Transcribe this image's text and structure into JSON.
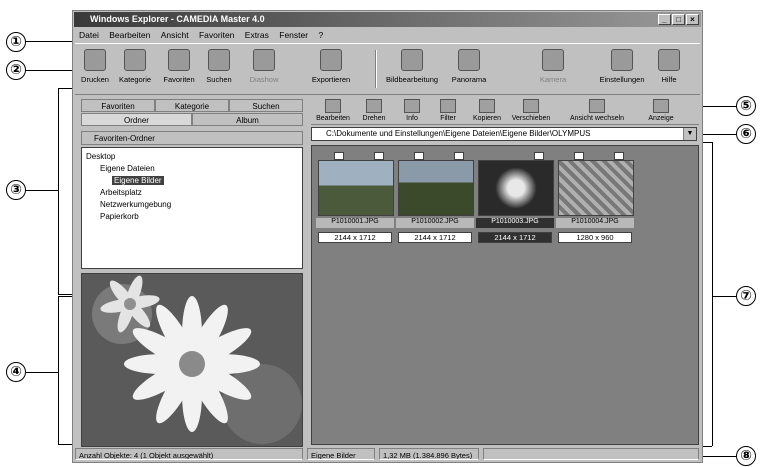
{
  "callouts": [
    "①",
    "②",
    "③",
    "④",
    "⑤",
    "⑥",
    "⑦",
    "⑧"
  ],
  "window": {
    "title": "Windows Explorer - CAMEDIA Master 4.0"
  },
  "menu": [
    "Datei",
    "Bearbeiten",
    "Ansicht",
    "Favoriten",
    "Extras",
    "Fenster",
    "?"
  ],
  "toolbar": [
    {
      "label": "Drucken",
      "icon": "printer-icon",
      "enabled": true
    },
    {
      "label": "Kategorie",
      "icon": "category-icon",
      "enabled": true
    },
    {
      "label": "Favoriten",
      "icon": "favorites-icon",
      "enabled": true
    },
    {
      "label": "Suchen",
      "icon": "search-icon",
      "enabled": true
    },
    {
      "label": "Diashow",
      "icon": "slideshow-icon",
      "enabled": false
    },
    {
      "label": "Exportieren",
      "icon": "export-icon",
      "enabled": true
    },
    {
      "label": "Bildbearbeitung",
      "icon": "edit-icon",
      "enabled": true
    },
    {
      "label": "Panorama",
      "icon": "panorama-icon",
      "enabled": true
    },
    {
      "label": "Kamera",
      "icon": "camera-icon",
      "enabled": false
    },
    {
      "label": "Einstellungen",
      "icon": "settings-icon",
      "enabled": true
    },
    {
      "label": "Hilfe",
      "icon": "help-icon",
      "enabled": true
    }
  ],
  "left": {
    "tabs": [
      "Favoriten",
      "Kategorie",
      "Suchen",
      "Ordner",
      "Album"
    ],
    "favorites_bar": "Favoriten-Ordner",
    "tree": [
      {
        "label": "Desktop",
        "level": 0,
        "selected": false
      },
      {
        "label": "Eigene Dateien",
        "level": 1,
        "selected": false
      },
      {
        "label": "Eigene Bilder",
        "level": 2,
        "selected": true
      },
      {
        "label": "Arbeitsplatz",
        "level": 1,
        "selected": false
      },
      {
        "label": "Netzwerkumgebung",
        "level": 1,
        "selected": false
      },
      {
        "label": "Papierkorb",
        "level": 1,
        "selected": false
      }
    ]
  },
  "imagetools": [
    {
      "label": "Bearbeiten",
      "icon": "edit-icon"
    },
    {
      "label": "Drehen",
      "icon": "rotate-icon"
    },
    {
      "label": "Info",
      "icon": "info-icon"
    },
    {
      "label": "Filter",
      "icon": "filter-icon"
    },
    {
      "label": "Kopieren",
      "icon": "copy-icon"
    },
    {
      "label": "Verschieben",
      "icon": "move-icon"
    },
    {
      "label": "Ansicht wechseln",
      "icon": "view-icon"
    },
    {
      "label": "Anzeige",
      "icon": "display-icon"
    }
  ],
  "address": "C:\\Dokumente und Einstellungen\\Eigene Dateien\\Eigene Bilder\\OLYMPUS",
  "thumbnails": [
    {
      "name": "P1010001.JPG",
      "size": "2144 x 1712",
      "selected": false,
      "colors": [
        "#9fb0c0",
        "#4a5a3a"
      ]
    },
    {
      "name": "P1010002.JPG",
      "size": "2144 x 1712",
      "selected": false,
      "colors": [
        "#8a9aa8",
        "#3a4a2a"
      ]
    },
    {
      "name": "P1010003.JPG",
      "size": "2144 x 1712",
      "selected": true,
      "colors": [
        "#2a2a2a",
        "#d8d8d8"
      ]
    },
    {
      "name": "P1010004.JPG",
      "size": "1280 x 960",
      "selected": false,
      "colors": [
        "#b0b0b0",
        "#707070"
      ]
    }
  ],
  "status": [
    "Anzahl Objekte: 4 (1 Objekt ausgewählt)",
    "Eigene Bilder",
    "1,32 MB (1.384.896 Bytes)"
  ]
}
